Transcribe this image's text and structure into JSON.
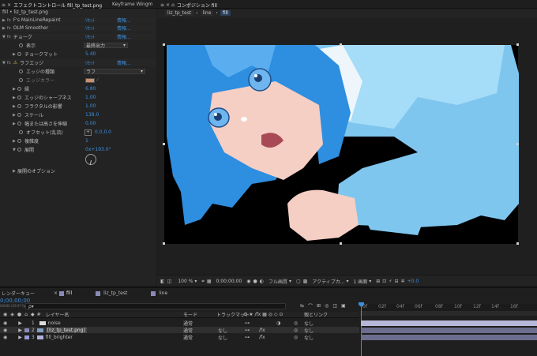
{
  "effect_controls": {
    "tab_title": "エフェクトコントロール fill_tp_test.png",
    "tab_other": "Keyframe Wingm",
    "layer_path": "fill • liz_tp_test.png",
    "effects": [
      {
        "name": "F's MainLineRepaint",
        "reset": "ﾘｾｯﾄ",
        "about": "情報..."
      },
      {
        "name": "OLM Smoother",
        "reset": "ﾘｾｯﾄ",
        "about": "情報..."
      },
      {
        "name": "チョーク",
        "reset": "ﾘｾｯﾄ",
        "about": "情報..."
      }
    ],
    "choke_props": [
      {
        "label": "表示",
        "value": "最終出力"
      },
      {
        "label": "チョークマット",
        "value": "5.40"
      }
    ],
    "roughen": {
      "name": "ラフエッジ",
      "reset": "ﾘｾｯﾄ",
      "about": "情報..."
    },
    "roughen_props": [
      {
        "label": "エッジの種類",
        "value": "ラフ"
      },
      {
        "label": "エッジカラー",
        "value": ""
      },
      {
        "label": "縁",
        "value": "6.80"
      },
      {
        "label": "エッジのシャープネス",
        "value": "1.00"
      },
      {
        "label": "フラクタルの影響",
        "value": "1.00"
      },
      {
        "label": "スケール",
        "value": "138.0"
      },
      {
        "label": "幅または高さを伸縮",
        "value": "0.00"
      },
      {
        "label": "オフセット(乱流)",
        "value": "0.0,0.0"
      },
      {
        "label": "複雑度",
        "value": "1"
      },
      {
        "label": "展開",
        "value": "0x+193.0°"
      }
    ],
    "evolution_options": "展開のオプション"
  },
  "composition": {
    "tab_title": "コンポジション fill",
    "crumbs": [
      "liz_tp_test",
      "line",
      "fill"
    ],
    "zoom": "100 %",
    "timecode": "0;00;00;00",
    "quality": "フル画質",
    "camera": "アクティブカ...",
    "views": "1 画面",
    "offset": "+0.0"
  },
  "timeline": {
    "tabs": [
      "レンダーキュー",
      "fill",
      "liz_tp_test",
      "line"
    ],
    "active_tab": "fill",
    "time": "0;00;00;00",
    "frame": "00000 (29.97 fps)",
    "search_placeholder": "ρ▾",
    "col_layer": "レイヤー名",
    "col_mode": "モード",
    "col_trkmat": "トラックマット",
    "col_parent": "親とリンク",
    "ruler": [
      "0f",
      "02f",
      "04f",
      "06f",
      "08f",
      "10f",
      "12f",
      "14f",
      "16f"
    ],
    "layers": [
      {
        "num": "1",
        "name": "noise",
        "mode": "通常",
        "trkmat": "",
        "parent": "なし",
        "color": "#b7b7d9"
      },
      {
        "num": "2",
        "name": "[liz_tp_test.png]",
        "mode": "通常",
        "trkmat": "なし",
        "parent": "なし",
        "color": "#8a8ab8"
      },
      {
        "num": "3",
        "name": "fill_brighter",
        "mode": "通常",
        "trkmat": "なし",
        "parent": "なし",
        "color": "#9a9ad8"
      }
    ]
  },
  "colors": {
    "accent_blue": "#3a8fe0",
    "panel": "#232323",
    "layer_bar": "#6d6d90"
  }
}
